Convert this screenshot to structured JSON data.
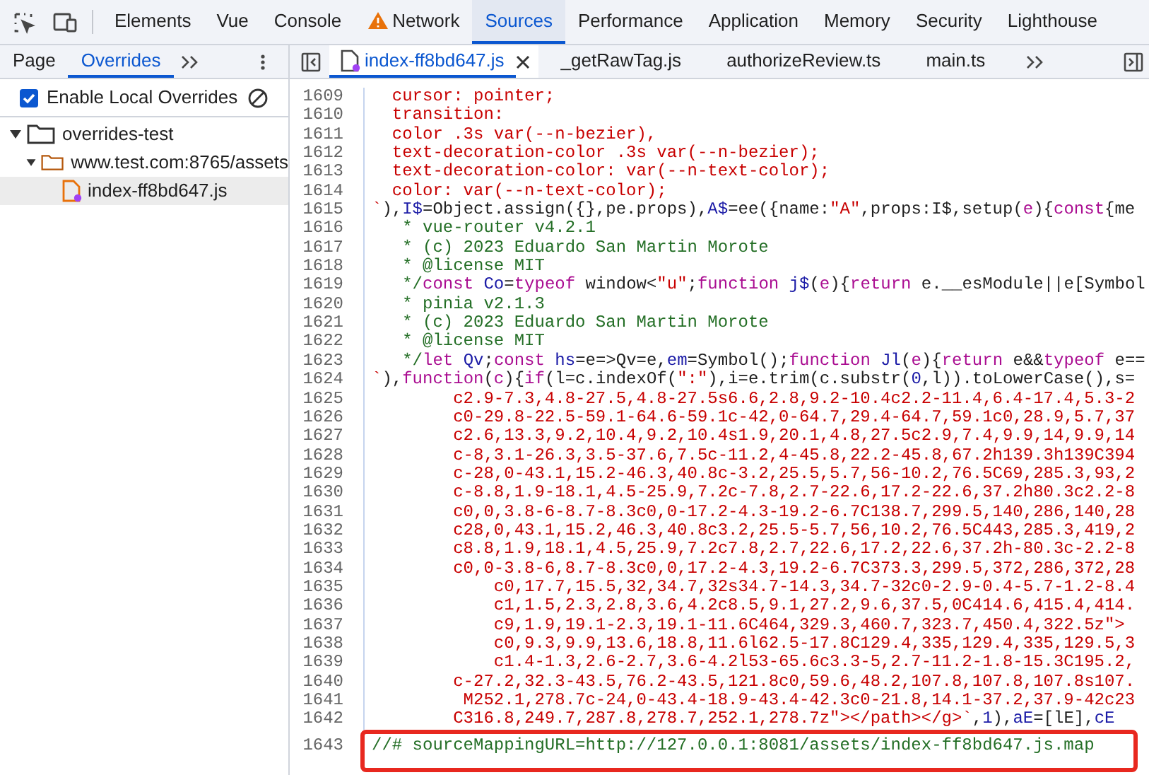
{
  "toolbar": {
    "tabs": [
      {
        "label": "Elements",
        "selected": false,
        "warning": false
      },
      {
        "label": "Vue",
        "selected": false,
        "warning": false
      },
      {
        "label": "Console",
        "selected": false,
        "warning": false
      },
      {
        "label": "Network",
        "selected": false,
        "warning": true
      },
      {
        "label": "Sources",
        "selected": true,
        "warning": false
      },
      {
        "label": "Performance",
        "selected": false,
        "warning": false
      },
      {
        "label": "Application",
        "selected": false,
        "warning": false
      },
      {
        "label": "Memory",
        "selected": false,
        "warning": false
      },
      {
        "label": "Security",
        "selected": false,
        "warning": false
      },
      {
        "label": "Lighthouse",
        "selected": false,
        "warning": false
      }
    ]
  },
  "navigator": {
    "tabs": [
      {
        "label": "Page",
        "selected": false
      },
      {
        "label": "Overrides",
        "selected": true
      }
    ],
    "enable_overrides": {
      "label": "Enable Local Overrides",
      "checked": true
    },
    "tree": [
      {
        "label": "overrides-test",
        "kind": "folder",
        "expanded": true,
        "selected": false,
        "children": [
          {
            "label": "www.test.com:8765/assets",
            "kind": "folder",
            "expanded": true,
            "selected": false,
            "children": [
              {
                "label": "index-ff8bd647.js",
                "kind": "file",
                "selected": true
              }
            ]
          }
        ]
      }
    ]
  },
  "editor": {
    "tabs": [
      {
        "label": "index-ff8bd647.js",
        "selected": true,
        "modified": true
      },
      {
        "label": "_getRawTag.js",
        "selected": false,
        "modified": false
      },
      {
        "label": "authorizeReview.ts",
        "selected": false,
        "modified": false
      },
      {
        "label": "main.ts",
        "selected": false,
        "modified": false
      }
    ],
    "lines": [
      {
        "number": "1609",
        "highlighted": false,
        "segments": [
          {
            "text": "  cursor: pointer;",
            "kind": "string"
          }
        ]
      },
      {
        "number": "1610",
        "highlighted": false,
        "segments": [
          {
            "text": "  transition:",
            "kind": "string"
          }
        ]
      },
      {
        "number": "1611",
        "highlighted": false,
        "segments": [
          {
            "text": "  color .3s var(--n-bezier),",
            "kind": "string"
          }
        ]
      },
      {
        "number": "1612",
        "highlighted": false,
        "segments": [
          {
            "text": "  text-decoration-color .3s var(--n-bezier);",
            "kind": "string"
          }
        ]
      },
      {
        "number": "1613",
        "highlighted": false,
        "segments": [
          {
            "text": "  text-decoration-color: var(--n-text-color);",
            "kind": "string"
          }
        ]
      },
      {
        "number": "1614",
        "highlighted": false,
        "segments": [
          {
            "text": "  color: var(--n-text-color);",
            "kind": "string"
          }
        ]
      },
      {
        "number": "1615",
        "highlighted": false,
        "segments": [
          {
            "text": "`",
            "kind": "string"
          },
          {
            "text": "),",
            "kind": "plain"
          },
          {
            "text": "I$",
            "kind": "name"
          },
          {
            "text": "=Object.assign({},pe.props),",
            "kind": "plain"
          },
          {
            "text": "A$",
            "kind": "name"
          },
          {
            "text": "=ee({name:",
            "kind": "plain"
          },
          {
            "text": "\"A\"",
            "kind": "string"
          },
          {
            "text": ",props:I$,setup(",
            "kind": "plain"
          },
          {
            "text": "e",
            "kind": "keyword"
          },
          {
            "text": "){",
            "kind": "plain"
          },
          {
            "text": "const",
            "kind": "keyword"
          },
          {
            "text": "{me",
            "kind": "plain"
          }
        ]
      },
      {
        "number": "1616",
        "highlighted": false,
        "segments": [
          {
            "text": "   * vue-router v4.2.1",
            "kind": "comment"
          }
        ]
      },
      {
        "number": "1617",
        "highlighted": false,
        "segments": [
          {
            "text": "   * (c) 2023 Eduardo San Martin Morote",
            "kind": "comment"
          }
        ]
      },
      {
        "number": "1618",
        "highlighted": false,
        "segments": [
          {
            "text": "   * @license MIT",
            "kind": "comment"
          }
        ]
      },
      {
        "number": "1619",
        "highlighted": false,
        "segments": [
          {
            "text": "   */",
            "kind": "comment"
          },
          {
            "text": "const",
            "kind": "keyword"
          },
          {
            "text": " Co",
            "kind": "name"
          },
          {
            "text": "=",
            "kind": "plain"
          },
          {
            "text": "typeof",
            "kind": "keyword"
          },
          {
            "text": " window<",
            "kind": "plain"
          },
          {
            "text": "\"u\"",
            "kind": "string"
          },
          {
            "text": ";",
            "kind": "plain"
          },
          {
            "text": "function",
            "kind": "keyword"
          },
          {
            "text": " j$",
            "kind": "name"
          },
          {
            "text": "(",
            "kind": "plain"
          },
          {
            "text": "e",
            "kind": "keyword"
          },
          {
            "text": "){",
            "kind": "plain"
          },
          {
            "text": "return",
            "kind": "keyword"
          },
          {
            "text": " e.__esModule||e[Symbol",
            "kind": "plain"
          }
        ]
      },
      {
        "number": "1620",
        "highlighted": false,
        "segments": [
          {
            "text": "   * pinia v2.1.3",
            "kind": "comment"
          }
        ]
      },
      {
        "number": "1621",
        "highlighted": false,
        "segments": [
          {
            "text": "   * (c) 2023 Eduardo San Martin Morote",
            "kind": "comment"
          }
        ]
      },
      {
        "number": "1622",
        "highlighted": false,
        "segments": [
          {
            "text": "   * @license MIT",
            "kind": "comment"
          }
        ]
      },
      {
        "number": "1623",
        "highlighted": false,
        "segments": [
          {
            "text": "   */",
            "kind": "comment"
          },
          {
            "text": "let",
            "kind": "keyword"
          },
          {
            "text": " Qv",
            "kind": "name"
          },
          {
            "text": ";",
            "kind": "plain"
          },
          {
            "text": "const",
            "kind": "keyword"
          },
          {
            "text": " hs",
            "kind": "name"
          },
          {
            "text": "=e=>Qv=e,",
            "kind": "plain"
          },
          {
            "text": "em",
            "kind": "name"
          },
          {
            "text": "=Symbol();",
            "kind": "plain"
          },
          {
            "text": "function",
            "kind": "keyword"
          },
          {
            "text": " Jl",
            "kind": "name"
          },
          {
            "text": "(",
            "kind": "plain"
          },
          {
            "text": "e",
            "kind": "keyword"
          },
          {
            "text": "){",
            "kind": "plain"
          },
          {
            "text": "return",
            "kind": "keyword"
          },
          {
            "text": " e&&",
            "kind": "plain"
          },
          {
            "text": "typeof",
            "kind": "keyword"
          },
          {
            "text": " e==",
            "kind": "plain"
          }
        ]
      },
      {
        "number": "1624",
        "highlighted": false,
        "segments": [
          {
            "text": "`",
            "kind": "string"
          },
          {
            "text": "),",
            "kind": "plain"
          },
          {
            "text": "function",
            "kind": "keyword"
          },
          {
            "text": "(",
            "kind": "plain"
          },
          {
            "text": "c",
            "kind": "keyword"
          },
          {
            "text": "){",
            "kind": "plain"
          },
          {
            "text": "if",
            "kind": "keyword"
          },
          {
            "text": "(l=c.indexOf(",
            "kind": "plain"
          },
          {
            "text": "\":\"",
            "kind": "string"
          },
          {
            "text": "),i=e.trim(c.substr(",
            "kind": "plain"
          },
          {
            "text": "0",
            "kind": "name"
          },
          {
            "text": ",l)).toLowerCase(),s=",
            "kind": "plain"
          }
        ]
      },
      {
        "number": "1625",
        "highlighted": false,
        "segments": [
          {
            "text": "        c2.9-7.3,4.8-27.5,4.8-27.5s6.6,2.8,9.2-10.4c2.2-11.4,6.4-17.4,5.3-2",
            "kind": "string"
          }
        ]
      },
      {
        "number": "1626",
        "highlighted": false,
        "segments": [
          {
            "text": "        c0-29.8-22.5-59.1-64.6-59.1c-42,0-64.7,29.4-64.7,59.1c0,28.9,5.7,37",
            "kind": "string"
          }
        ]
      },
      {
        "number": "1627",
        "highlighted": false,
        "segments": [
          {
            "text": "        c2.6,13.3,9.2,10.4,9.2,10.4s1.9,20.1,4.8,27.5c2.9,7.4,9.9,14,9.9,14",
            "kind": "string"
          }
        ]
      },
      {
        "number": "1628",
        "highlighted": false,
        "segments": [
          {
            "text": "        c-8,3.1-26.3,3.5-37.6,7.5c-11.2,4-45.8,22.2-45.8,67.2h139.3h139C394",
            "kind": "string"
          }
        ]
      },
      {
        "number": "1629",
        "highlighted": false,
        "segments": [
          {
            "text": "        c-28,0-43.1,15.2-46.3,40.8c-3.2,25.5,5.7,56-10.2,76.5C69,285.3,93,2",
            "kind": "string"
          }
        ]
      },
      {
        "number": "1630",
        "highlighted": false,
        "segments": [
          {
            "text": "        c-8.8,1.9-18.1,4.5-25.9,7.2c-7.8,2.7-22.6,17.2-22.6,37.2h80.3c2.2-8",
            "kind": "string"
          }
        ]
      },
      {
        "number": "1631",
        "highlighted": false,
        "segments": [
          {
            "text": "        c0,0,3.8-6-8.7-8.3c0,0-17.2-4.3-19.2-6.7C138.7,299.5,140,286,140,28",
            "kind": "string"
          }
        ]
      },
      {
        "number": "1632",
        "highlighted": false,
        "segments": [
          {
            "text": "        c28,0,43.1,15.2,46.3,40.8c3.2,25.5-5.7,56,10.2,76.5C443,285.3,419,2",
            "kind": "string"
          }
        ]
      },
      {
        "number": "1633",
        "highlighted": false,
        "segments": [
          {
            "text": "        c8.8,1.9,18.1,4.5,25.9,7.2c7.8,2.7,22.6,17.2,22.6,37.2h-80.3c-2.2-8",
            "kind": "string"
          }
        ]
      },
      {
        "number": "1634",
        "highlighted": false,
        "segments": [
          {
            "text": "        c0,0-3.8-6,8.7-8.3c0,0,17.2-4.3,19.2-6.7C373.3,299.5,372,286,372,28",
            "kind": "string"
          }
        ]
      },
      {
        "number": "1635",
        "highlighted": false,
        "segments": [
          {
            "text": "            c0,17.7,15.5,32,34.7,32s34.7-14.3,34.7-32c0-2.9-0.4-5.7-1.2-8.4",
            "kind": "string"
          }
        ]
      },
      {
        "number": "1636",
        "highlighted": false,
        "segments": [
          {
            "text": "            c1,1.5,2.3,2.8,3.6,4.2c8.5,9.1,27.2,9.6,37.5,0C414.6,415.4,414.",
            "kind": "string"
          }
        ]
      },
      {
        "number": "1637",
        "highlighted": false,
        "segments": [
          {
            "text": "            c9,1.9,19.1-2.3,19.1-11.6C464,329.3,460.7,323.7,450.4,322.5z\">",
            "kind": "string"
          }
        ]
      },
      {
        "number": "1638",
        "highlighted": false,
        "segments": [
          {
            "text": "            c0,9.3,9.9,13.6,18.8,11.6l62.5-17.8C129.4,335,129.4,335,129.5,3",
            "kind": "string"
          }
        ]
      },
      {
        "number": "1639",
        "highlighted": false,
        "segments": [
          {
            "text": "            c1.4-1.3,2.6-2.7,3.6-4.2l53-65.6c3.3-5,2.7-11.2-1.8-15.3C195.2,",
            "kind": "string"
          }
        ]
      },
      {
        "number": "1640",
        "highlighted": false,
        "segments": [
          {
            "text": "        c-27.2,32.3-43.5,76.2-43.5,121.8c0,59.6,48.2,107.8,107.8,107.8s107.",
            "kind": "string"
          }
        ]
      },
      {
        "number": "1641",
        "highlighted": false,
        "segments": [
          {
            "text": "         M252.1,278.7c-24,0-43.4-18.9-43.4-42.3c0-21.8,14.1-37.2,37.9-42c23",
            "kind": "string"
          }
        ]
      },
      {
        "number": "1642",
        "highlighted": false,
        "segments": [
          {
            "text": "        C316.8,249.7,287.8,278.7,252.1,278.7z\"></path></g>`",
            "kind": "string"
          },
          {
            "text": ",",
            "kind": "plain"
          },
          {
            "text": "1",
            "kind": "name"
          },
          {
            "text": "),",
            "kind": "plain"
          },
          {
            "text": "aE",
            "kind": "name"
          },
          {
            "text": "=[lE],",
            "kind": "plain"
          },
          {
            "text": "cE",
            "kind": "name"
          }
        ]
      },
      {
        "number": "1643",
        "highlighted": true,
        "segments": [
          {
            "text": "//# sourceMappingURL=http://127.0.0.1:8081/assets/index-ff8bd647.js.map",
            "kind": "comment"
          }
        ]
      }
    ]
  }
}
